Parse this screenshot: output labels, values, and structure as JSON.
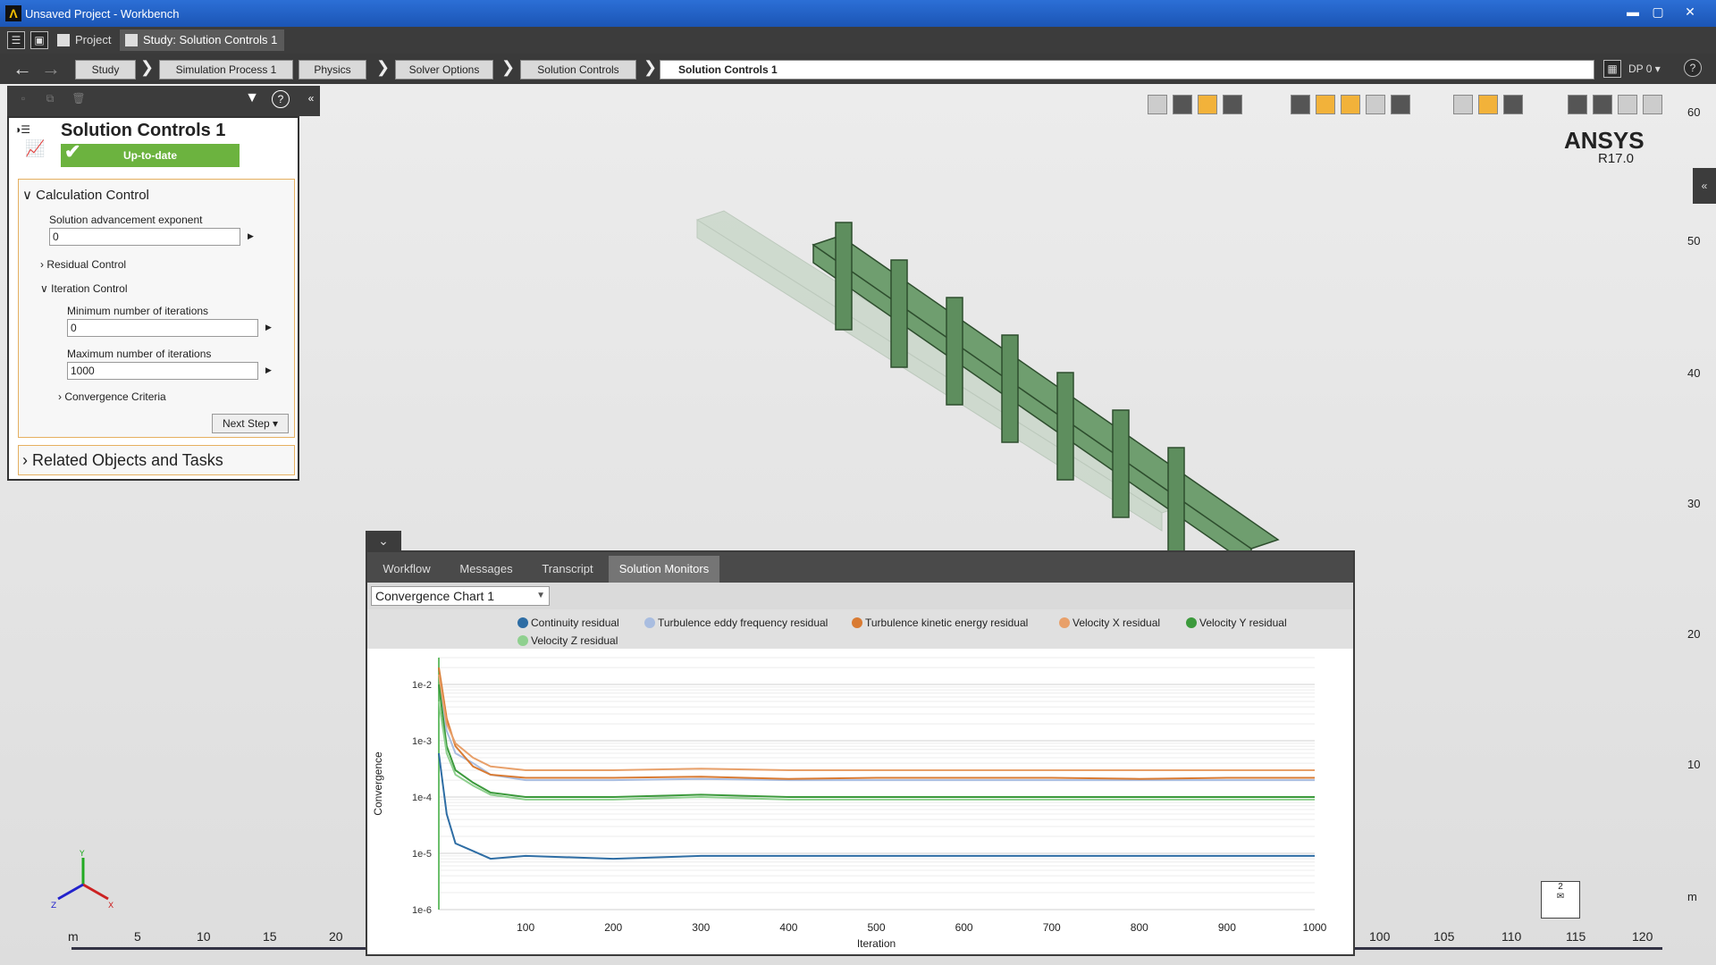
{
  "window": {
    "title": "Unsaved Project - Workbench",
    "logo": "Λ",
    "minimize": "▬",
    "maximize": "▢",
    "close": "✕"
  },
  "tabs": [
    {
      "label": "Project"
    },
    {
      "label": "Study: Solution Controls 1"
    }
  ],
  "breadcrumb": {
    "items": [
      "Study",
      "Simulation Process 1",
      "Physics",
      "Solver Options",
      "Solution Controls"
    ],
    "current": "Solution Controls 1",
    "dp": "DP 0 ▾"
  },
  "panel": {
    "title": "Solution Controls 1",
    "status": "Up-to-date",
    "calc_group": "Calculation Control",
    "adv_exp_label": "Solution advancement exponent",
    "adv_exp_value": "0",
    "residual_control": "Residual Control",
    "iteration_control": "Iteration Control",
    "min_iter_label": "Minimum number of iterations",
    "min_iter_value": "0",
    "max_iter_label": "Maximum number of iterations",
    "max_iter_value": "1000",
    "convergence": "Convergence Criteria",
    "next_step": "Next Step ▾",
    "related": "Related Objects and Tasks"
  },
  "brand": {
    "name": "ANSYS",
    "version": "R17.0"
  },
  "scale": {
    "vertical": [
      "60",
      "50",
      "40",
      "30",
      "20",
      "10",
      "m"
    ],
    "horizontal": [
      "m",
      "5",
      "10",
      "15",
      "20",
      "100",
      "105",
      "110",
      "115",
      "120"
    ]
  },
  "dock": {
    "tabs": [
      "Workflow",
      "Messages",
      "Transcript",
      "Solution Monitors"
    ],
    "active_tab": 3,
    "chart_select": "Convergence Chart 1"
  },
  "colors": {
    "accent": "#f2b23a",
    "status_green": "#6cb33f",
    "geometry_green": "#4a7a4a"
  },
  "chart_data": {
    "type": "line",
    "title": "",
    "xlabel": "Iteration",
    "ylabel": "Convergence",
    "log_y": true,
    "xlim": [
      1,
      1000
    ],
    "ylim": [
      1e-06,
      0.03
    ],
    "x_ticks": [
      100,
      200,
      300,
      400,
      500,
      600,
      700,
      800,
      900,
      1000
    ],
    "y_ticks": [
      "1e-2",
      "1e-3",
      "1e-4",
      "1e-5",
      "1e-6"
    ],
    "legend_position": "top",
    "grid": true,
    "series": [
      {
        "name": "Continuity residual",
        "color": "#2e6da4",
        "x": [
          1,
          10,
          20,
          40,
          60,
          100,
          200,
          300,
          400,
          500,
          600,
          700,
          800,
          900,
          1000
        ],
        "y": [
          0.0006,
          5e-05,
          1.5e-05,
          1.1e-05,
          8e-06,
          9e-06,
          8e-06,
          9e-06,
          9e-06,
          9e-06,
          9e-06,
          9e-06,
          9e-06,
          9e-06,
          9e-06
        ]
      },
      {
        "name": "Turbulence eddy frequency residual",
        "color": "#a9bde0",
        "x": [
          1,
          10,
          20,
          40,
          60,
          100,
          200,
          300,
          400,
          500,
          600,
          700,
          800,
          900,
          1000
        ],
        "y": [
          0.01,
          0.0015,
          0.0006,
          0.0004,
          0.00025,
          0.0002,
          0.0002,
          0.00021,
          0.0002,
          0.0002,
          0.0002,
          0.0002,
          0.0002,
          0.0002,
          0.0002
        ]
      },
      {
        "name": "Turbulence kinetic energy residual",
        "color": "#d97b33",
        "x": [
          1,
          10,
          20,
          40,
          60,
          100,
          200,
          300,
          400,
          500,
          600,
          700,
          800,
          900,
          1000
        ],
        "y": [
          0.02,
          0.0025,
          0.0008,
          0.00035,
          0.00025,
          0.00022,
          0.00022,
          0.00023,
          0.00021,
          0.00022,
          0.00022,
          0.00022,
          0.00021,
          0.00022,
          0.00022
        ]
      },
      {
        "name": "Velocity X residual",
        "color": "#e8a06a",
        "x": [
          1,
          10,
          20,
          40,
          60,
          100,
          200,
          300,
          400,
          500,
          600,
          700,
          800,
          900,
          1000
        ],
        "y": [
          0.015,
          0.002,
          0.0009,
          0.0005,
          0.00035,
          0.0003,
          0.0003,
          0.00032,
          0.0003,
          0.0003,
          0.0003,
          0.0003,
          0.0003,
          0.0003,
          0.0003
        ]
      },
      {
        "name": "Velocity Y residual",
        "color": "#3c9a3c",
        "x": [
          1,
          10,
          20,
          40,
          60,
          100,
          200,
          300,
          400,
          500,
          600,
          700,
          800,
          900,
          1000
        ],
        "y": [
          0.01,
          0.0008,
          0.0003,
          0.00018,
          0.00012,
          0.0001,
          0.0001,
          0.00011,
          0.0001,
          0.0001,
          0.0001,
          0.0001,
          0.0001,
          0.0001,
          0.0001
        ]
      },
      {
        "name": "Velocity Z residual",
        "color": "#8fd08f",
        "x": [
          1,
          10,
          20,
          40,
          60,
          100,
          200,
          300,
          400,
          500,
          600,
          700,
          800,
          900,
          1000
        ],
        "y": [
          0.005,
          0.0006,
          0.00025,
          0.00016,
          0.00011,
          9e-05,
          9e-05,
          0.0001,
          9e-05,
          9e-05,
          9e-05,
          9e-05,
          9e-05,
          9e-05,
          9e-05
        ]
      }
    ]
  }
}
